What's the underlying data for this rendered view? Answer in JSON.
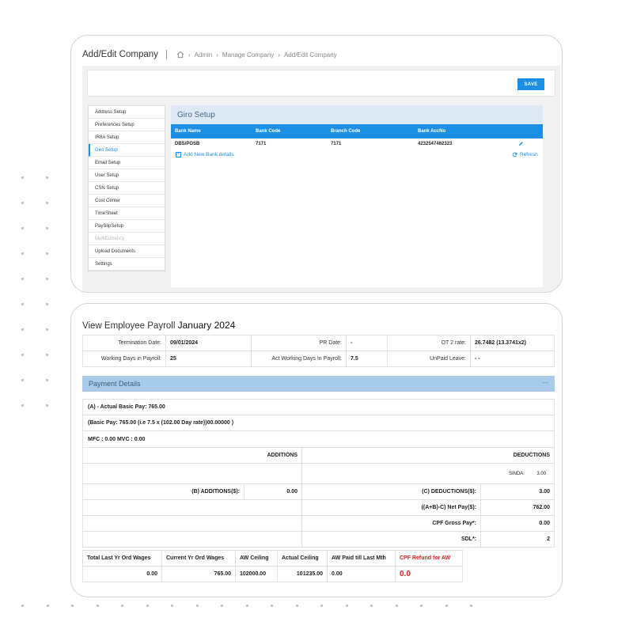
{
  "company": {
    "title": "Add/Edit Company",
    "breadcrumb": [
      "Admin",
      "Manage Company",
      "Add/Edit Company"
    ],
    "save_label": "SAVE",
    "menu": [
      {
        "label": "Address Setup",
        "state": "normal"
      },
      {
        "label": "Preferences Setup",
        "state": "normal"
      },
      {
        "label": "IR8A Setup",
        "state": "normal"
      },
      {
        "label": "Giro Setup",
        "state": "active"
      },
      {
        "label": "Email Setup",
        "state": "normal"
      },
      {
        "label": "User Setup",
        "state": "normal"
      },
      {
        "label": "CSN Setup",
        "state": "normal"
      },
      {
        "label": "Cost Center",
        "state": "normal"
      },
      {
        "label": "TimeSheet",
        "state": "normal"
      },
      {
        "label": "PaySlipSetup",
        "state": "normal"
      },
      {
        "label": "MultiCurrency",
        "state": "disabled"
      },
      {
        "label": "Upload Documents",
        "state": "normal"
      },
      {
        "label": "Settings",
        "state": "normal"
      }
    ],
    "giro": {
      "title": "Giro Setup",
      "columns": [
        "Bank Name",
        "Bank Code",
        "Branch Code",
        "Bank AccNo"
      ],
      "rows": [
        [
          "DBS/POSB",
          "7171",
          "7171",
          "4232547462323"
        ]
      ],
      "add_label": "Add New Bank details",
      "refresh_label": "Refresh"
    }
  },
  "payroll": {
    "title_prefix": "View Employee Payroll",
    "title_period": "January 2024",
    "info": {
      "termination_label": "Termination Date:",
      "termination_value": "09/01/2024",
      "pr_label": "PR Date:",
      "pr_value": "-",
      "ot2_label": "OT 2 rate:",
      "ot2_value": "26.7482 (13.3741x2)",
      "wd_label": "Working Days in Payroll:",
      "wd_value": "25",
      "awd_label": "Act Working Days In Payroll:",
      "awd_value": "7.5",
      "unpaid_label": "UnPaid Leave:",
      "unpaid_value": "- -"
    },
    "payment_title": "Payment Details",
    "collapse_symbol": "—",
    "actual_basic": "(A) - Actual Basic Pay: 765.00",
    "basic_detail": "(Basic Pay: 765.00 (i.e 7.5 x (102.00 Day rate))00.00000 )",
    "mfc_mvc": "MFC : 0.00 MVC : 0.00",
    "additions_label": "ADDITIONS",
    "deductions_label": "DEDUCTIONS",
    "sinda_label": "SINDA:",
    "sinda_value": "3.00",
    "b_additions_label": "(B) ADDITIONS($):",
    "b_additions_value": "0.00",
    "c_deductions_label": "(C) DEDUCTIONS($):",
    "c_deductions_value": "3.00",
    "net_pay_label": "((A+B)-C) Net Pay($):",
    "net_pay_value": "762.00",
    "cpf_gross_label": "CPF Gross Pay*:",
    "cpf_gross_value": "0.00",
    "sdl_label": "SDL*:",
    "sdl_value": "2",
    "summary_headers": [
      "Total Last Yr Ord Wages",
      "Current Yr Ord Wages",
      "AW Ceiling",
      "Actual Ceiling",
      "AW Paid till Last Mth",
      "CPF Refund for AW"
    ],
    "summary_values": [
      "0.00",
      "765.00",
      "102000.00",
      "101235.00",
      "0.00",
      "0.0"
    ]
  },
  "colors": {
    "accent": "#1a8fe3",
    "panel_header": "#a9cbea",
    "refund": "#e02020"
  }
}
